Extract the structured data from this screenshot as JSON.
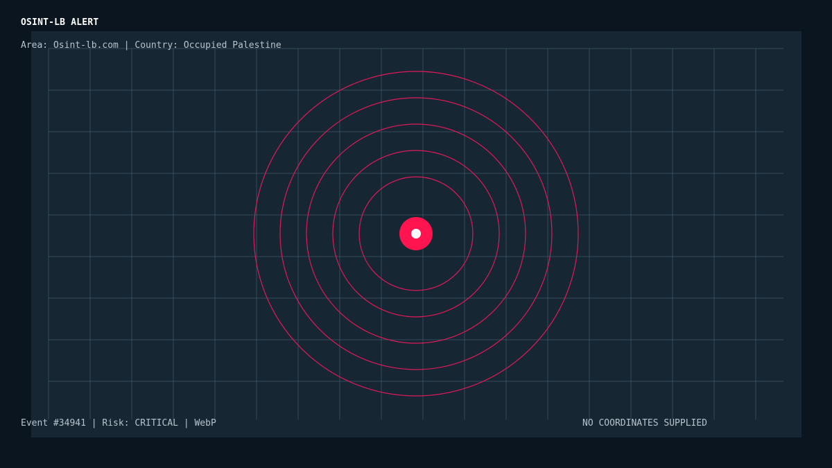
{
  "header": {
    "title": "OSINT-LB ALERT",
    "area_label": "Area:",
    "area_value": "Osint-lb.com",
    "separator": "|",
    "country_label": "Country:",
    "country_value": "Occupied Palestine"
  },
  "footer": {
    "event": "Event #34941",
    "risk_label": "Risk:",
    "risk_value": "CRITICAL",
    "format": "WebP",
    "separator": "|",
    "coordinates_status": "NO COORDINATES SUPPLIED"
  },
  "radar": {
    "ring_count": 5,
    "target_color": "#ff1450",
    "ring_color": "#e01a5a",
    "grid_color": "#3b5566",
    "panel_color": "#162633",
    "background_color": "#0b1520"
  }
}
